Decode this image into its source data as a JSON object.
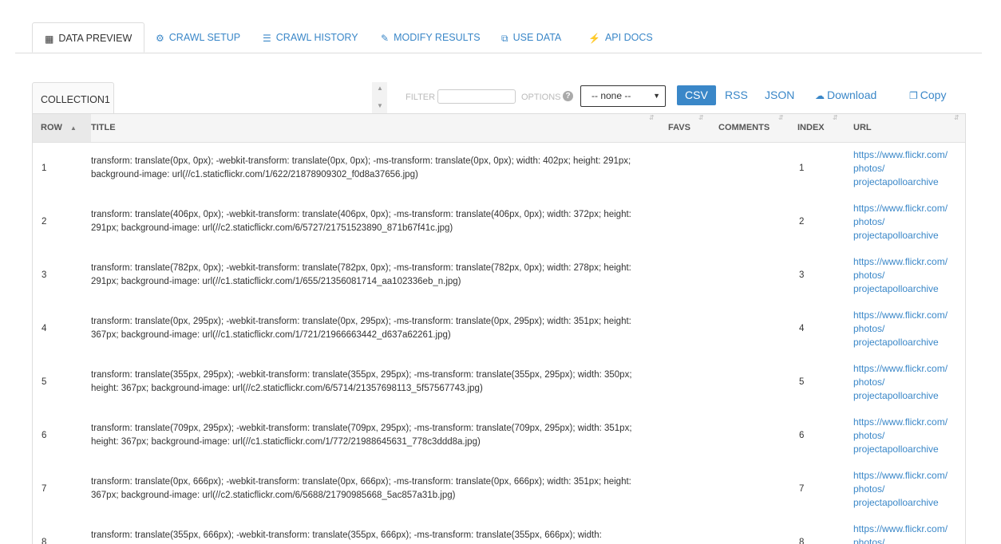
{
  "nav": {
    "tabs": [
      {
        "label": "DATA PREVIEW",
        "icon": "table-icon"
      },
      {
        "label": "CRAWL SETUP",
        "icon": "gear-icon"
      },
      {
        "label": "CRAWL HISTORY",
        "icon": "list-icon"
      },
      {
        "label": "MODIFY RESULTS",
        "icon": "pencil-icon"
      },
      {
        "label": "USE DATA",
        "icon": "share-icon"
      },
      {
        "label": "API DOCS",
        "icon": "bolt-icon"
      }
    ]
  },
  "toolbar": {
    "collection_tab": "COLLECTION1",
    "filter_label": "FILTER",
    "options_label": "OPTIONS",
    "select_value": "-- none --",
    "csv_label": "CSV",
    "rss_label": "RSS",
    "json_label": "JSON",
    "download_label": "Download",
    "copy_label": "Copy"
  },
  "table": {
    "headers": {
      "row": "ROW",
      "title": "TITLE",
      "favs": "FAVS",
      "comments": "COMMENTS",
      "index": "INDEX",
      "url": "URL"
    },
    "rows": [
      {
        "row": "1",
        "title": "transform: translate(0px, 0px); -webkit-transform: translate(0px, 0px); -ms-transform: translate(0px, 0px); width: 402px; height: 291px; background-image: url(//c1.staticflickr.com/1/622/21878909302_f0d8a37656.jpg)",
        "index": "1",
        "url": "https://www.flickr.com/ photos/ projectapolloarchive"
      },
      {
        "row": "2",
        "title": "transform: translate(406px, 0px); -webkit-transform: translate(406px, 0px); -ms-transform: translate(406px, 0px); width: 372px; height: 291px; background-image: url(//c2.staticflickr.com/6/5727/21751523890_871b67f41c.jpg)",
        "index": "2",
        "url": "https://www.flickr.com/ photos/ projectapolloarchive"
      },
      {
        "row": "3",
        "title": "transform: translate(782px, 0px); -webkit-transform: translate(782px, 0px); -ms-transform: translate(782px, 0px); width: 278px; height: 291px; background-image: url(//c1.staticflickr.com/1/655/21356081714_aa102336eb_n.jpg)",
        "index": "3",
        "url": "https://www.flickr.com/ photos/ projectapolloarchive"
      },
      {
        "row": "4",
        "title": "transform: translate(0px, 295px); -webkit-transform: translate(0px, 295px); -ms-transform: translate(0px, 295px); width: 351px; height: 367px; background-image: url(//c1.staticflickr.com/1/721/21966663442_d637a62261.jpg)",
        "index": "4",
        "url": "https://www.flickr.com/ photos/ projectapolloarchive"
      },
      {
        "row": "5",
        "title": "transform: translate(355px, 295px); -webkit-transform: translate(355px, 295px); -ms-transform: translate(355px, 295px); width: 350px; height: 367px; background-image: url(//c2.staticflickr.com/6/5714/21357698113_5f57567743.jpg)",
        "index": "5",
        "url": "https://www.flickr.com/ photos/ projectapolloarchive"
      },
      {
        "row": "6",
        "title": "transform: translate(709px, 295px); -webkit-transform: translate(709px, 295px); -ms-transform: translate(709px, 295px); width: 351px; height: 367px; background-image: url(//c1.staticflickr.com/1/772/21988645631_778c3ddd8a.jpg)",
        "index": "6",
        "url": "https://www.flickr.com/ photos/ projectapolloarchive"
      },
      {
        "row": "7",
        "title": "transform: translate(0px, 666px); -webkit-transform: translate(0px, 666px); -ms-transform: translate(0px, 666px); width: 351px; height: 367px; background-image: url(//c2.staticflickr.com/6/5688/21790985668_5ac857a31b.jpg)",
        "index": "7",
        "url": "https://www.flickr.com/ photos/ projectapolloarchive"
      },
      {
        "row": "8",
        "title": "transform: translate(355px, 666px); -webkit-transform: translate(355px, 666px); -ms-transform: translate(355px, 666px); width:",
        "index": "8",
        "url": "https://www.flickr.com/ photos/ projectapolloarchive"
      }
    ]
  }
}
